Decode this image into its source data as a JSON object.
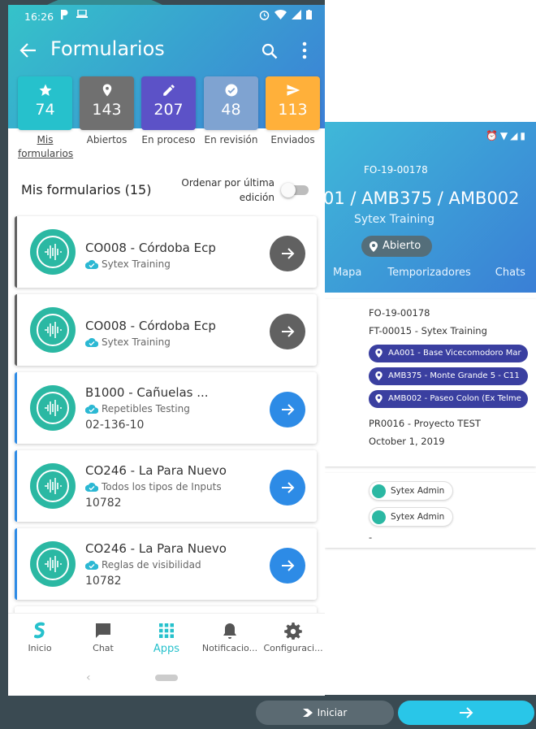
{
  "phone": {
    "status": {
      "time": "16:26"
    },
    "toolbar": {
      "title": "Formularios"
    },
    "stats": [
      {
        "value": "74",
        "label": "Mis formularios",
        "color": "#26c1cc",
        "icon": "star-icon"
      },
      {
        "value": "143",
        "label": "Abiertos",
        "color": "#707070",
        "icon": "location-pin-icon"
      },
      {
        "value": "207",
        "label": "En proceso",
        "color": "#5c52c7",
        "icon": "pencil-icon"
      },
      {
        "value": "48",
        "label": "En revisión",
        "color": "#7fa3d1",
        "icon": "check-circle-icon"
      },
      {
        "value": "113",
        "label": "Enviados",
        "color": "#ffb03a",
        "icon": "send-icon"
      }
    ],
    "section": {
      "title": "Mis formularios (15)",
      "sort_label": "Ordenar por última edición"
    },
    "cards": [
      {
        "title": "CO008 - Córdoba Ecp",
        "subtitle": "Sytex Training",
        "extra": "",
        "accent": "#616161",
        "button": "#616161"
      },
      {
        "title": "CO008 - Córdoba Ecp",
        "subtitle": "Sytex Training",
        "extra": "",
        "accent": "#616161",
        "button": "#616161"
      },
      {
        "title": "B1000 - Cañuelas ...",
        "subtitle": "Repetibles Testing",
        "extra": "02-136-10",
        "accent": "#2d8be6",
        "button": "#2d8be6"
      },
      {
        "title": "CO246 - La Para Nuevo",
        "subtitle": "Todos los tipos de Inputs",
        "extra": "10782",
        "accent": "#2d8be6",
        "button": "#2d8be6"
      },
      {
        "title": "CO246 - La Para Nuevo",
        "subtitle": "Reglas de visibilidad",
        "extra": "10782",
        "accent": "#2d8be6",
        "button": "#2d8be6"
      }
    ],
    "nav": [
      {
        "label": "Inicio",
        "icon": "sytex-logo-icon"
      },
      {
        "label": "Chat",
        "icon": "chat-icon"
      },
      {
        "label": "Apps",
        "icon": "apps-grid-icon"
      },
      {
        "label": "Notificacio...",
        "icon": "bell-icon"
      },
      {
        "label": "Configuraci...",
        "icon": "gear-icon"
      }
    ]
  },
  "detail": {
    "code": "FO-19-00178",
    "title": "01 / AMB375 / AMB002",
    "subtitle": "Sytex Training",
    "status": "Abierto",
    "tabs": [
      "Mapa",
      "Temporizadores",
      "Chats"
    ],
    "info": {
      "code": "FO-19-00178",
      "template": "FT-00015 - Sytex Training",
      "locations": [
        "AA001 - Base Vicecomodoro Mar",
        "AMB375 - Monte Grande 5 - C11",
        "AMB002 - Paseo Colon (Ex Telme"
      ],
      "project": "PR0016 - Proyecto TEST",
      "date": "October 1, 2019"
    },
    "people": [
      "Sytex Admin",
      "Sytex Admin"
    ],
    "dash": "-",
    "actions": {
      "start": "Iniciar"
    }
  }
}
